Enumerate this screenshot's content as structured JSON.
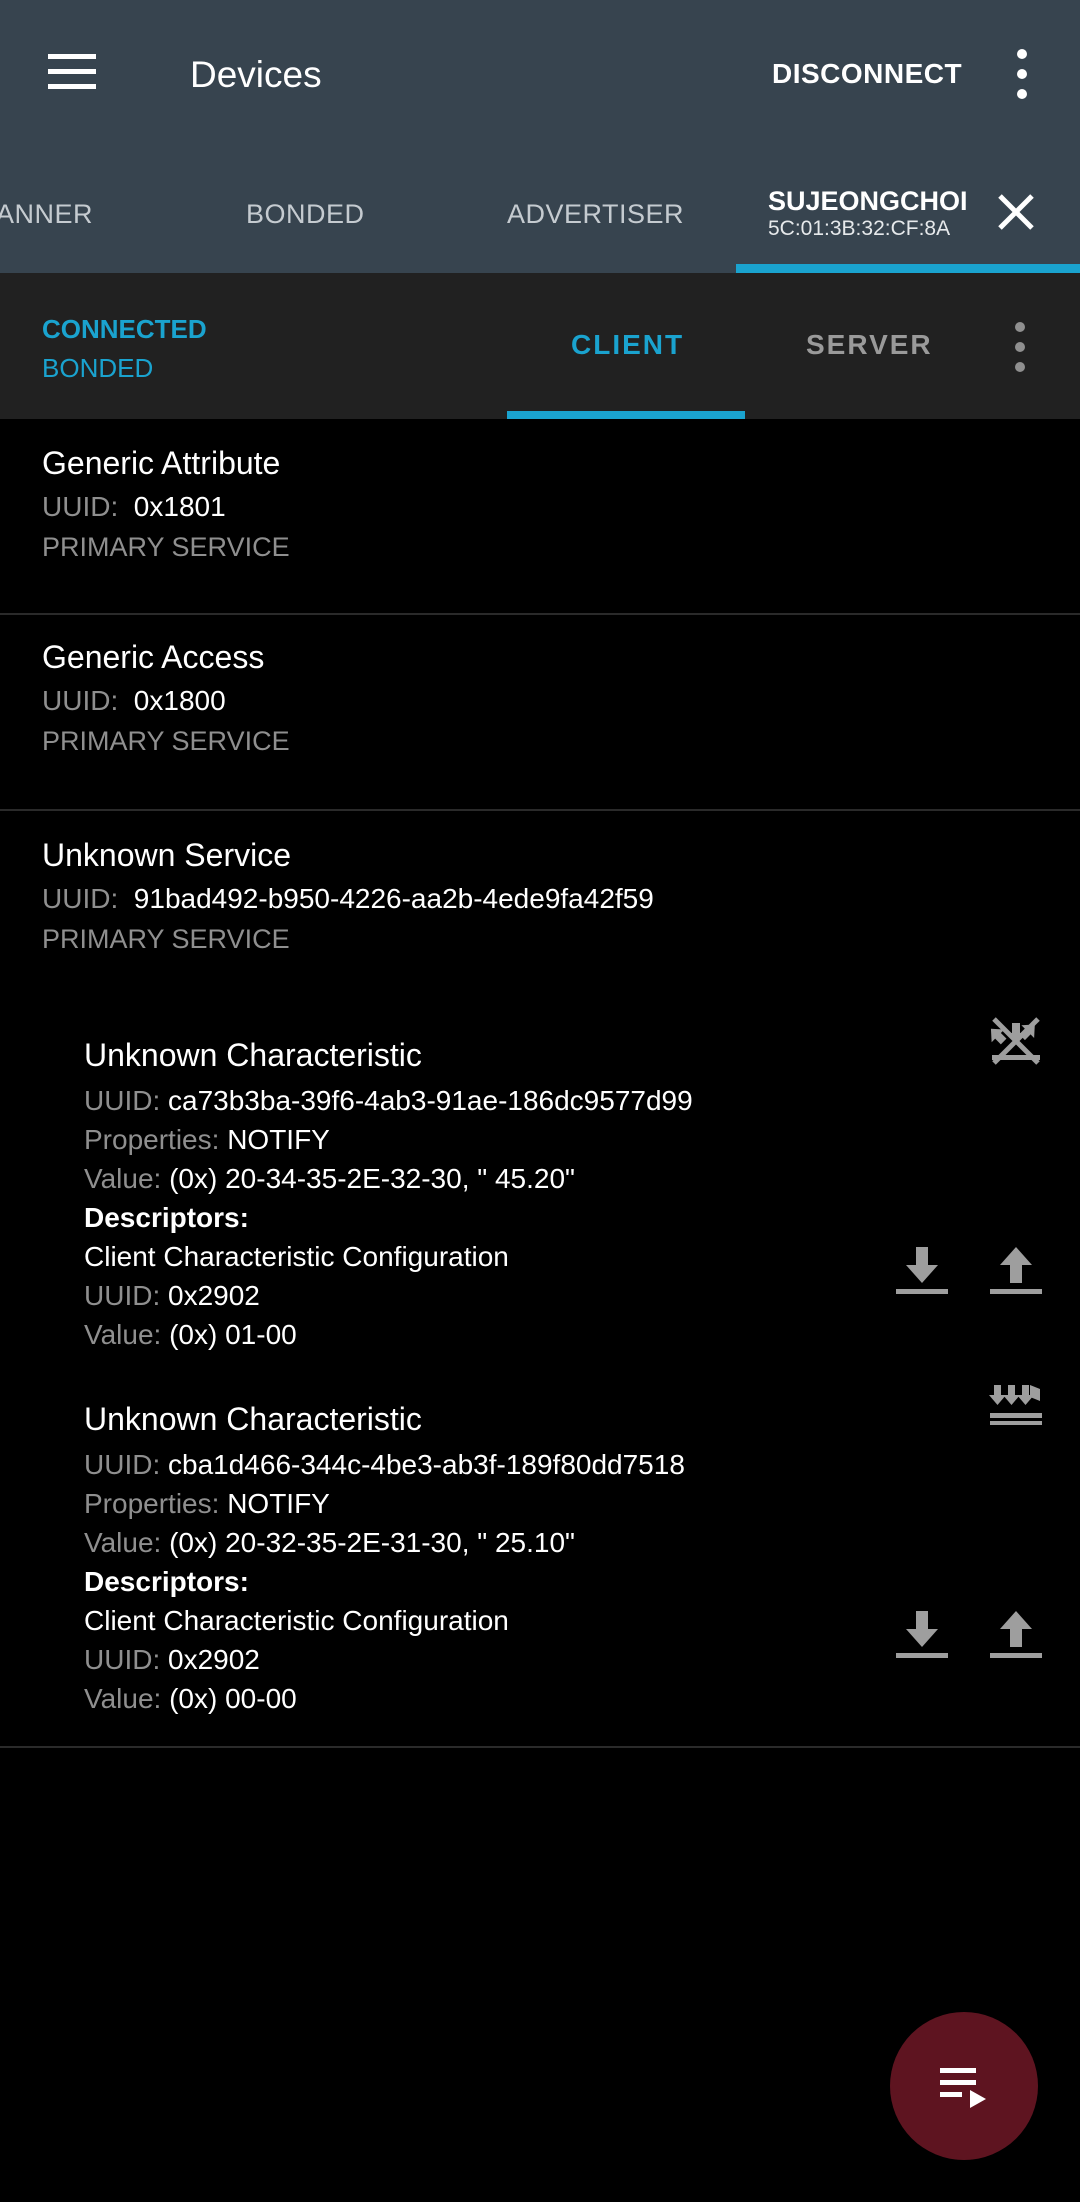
{
  "appbar": {
    "title": "Devices",
    "disconnect_label": "DISCONNECT"
  },
  "device_tabs": {
    "items": [
      {
        "label": "ANNER"
      },
      {
        "label": "BONDED"
      },
      {
        "label": "ADVERTISER"
      }
    ],
    "active": {
      "name": "SUJEONGCHOI",
      "address": "5C:01:3B:32:CF:8A"
    }
  },
  "connection": {
    "state": "CONNECTED",
    "bond_state": "BONDED",
    "tabs": [
      {
        "label": "CLIENT",
        "selected": true
      },
      {
        "label": "SERVER",
        "selected": false
      }
    ]
  },
  "labels": {
    "uuid": "UUID:",
    "properties": "Properties:",
    "value": "Value:",
    "descriptors": "Descriptors:"
  },
  "services": [
    {
      "name": "Generic Attribute",
      "uuid": "0x1801",
      "type": "PRIMARY SERVICE"
    },
    {
      "name": "Generic Access",
      "uuid": "0x1800",
      "type": "PRIMARY SERVICE"
    },
    {
      "name": "Unknown Service",
      "uuid": "91bad492-b950-4226-aa2b-4ede9fa42f59",
      "type": "PRIMARY SERVICE",
      "characteristics": [
        {
          "name": "Unknown Characteristic",
          "uuid": "ca73b3ba-39f6-4ab3-91ae-186dc9577d99",
          "properties": "NOTIFY",
          "value": "(0x) 20-34-35-2E-32-30, \" 45.20\"",
          "notify_icon": "notifications-disabled-icon",
          "descriptor": {
            "name": "Client Characteristic Configuration",
            "uuid": "0x2902",
            "value": "(0x) 01-00"
          }
        },
        {
          "name": "Unknown Characteristic",
          "uuid": "cba1d466-344c-4be3-ab3f-189f80dd7518",
          "properties": "NOTIFY",
          "value": "(0x) 20-32-35-2E-31-30, \" 25.10\"",
          "notify_icon": "notifications-enabled-icon",
          "descriptor": {
            "name": "Client Characteristic Configuration",
            "uuid": "0x2902",
            "value": "(0x) 00-00"
          }
        }
      ]
    }
  ],
  "colors": {
    "appbar": "#37444f",
    "accent": "#1aa3cf",
    "status_bar": "#212121",
    "background": "#000000",
    "fab": "#5e1420"
  }
}
